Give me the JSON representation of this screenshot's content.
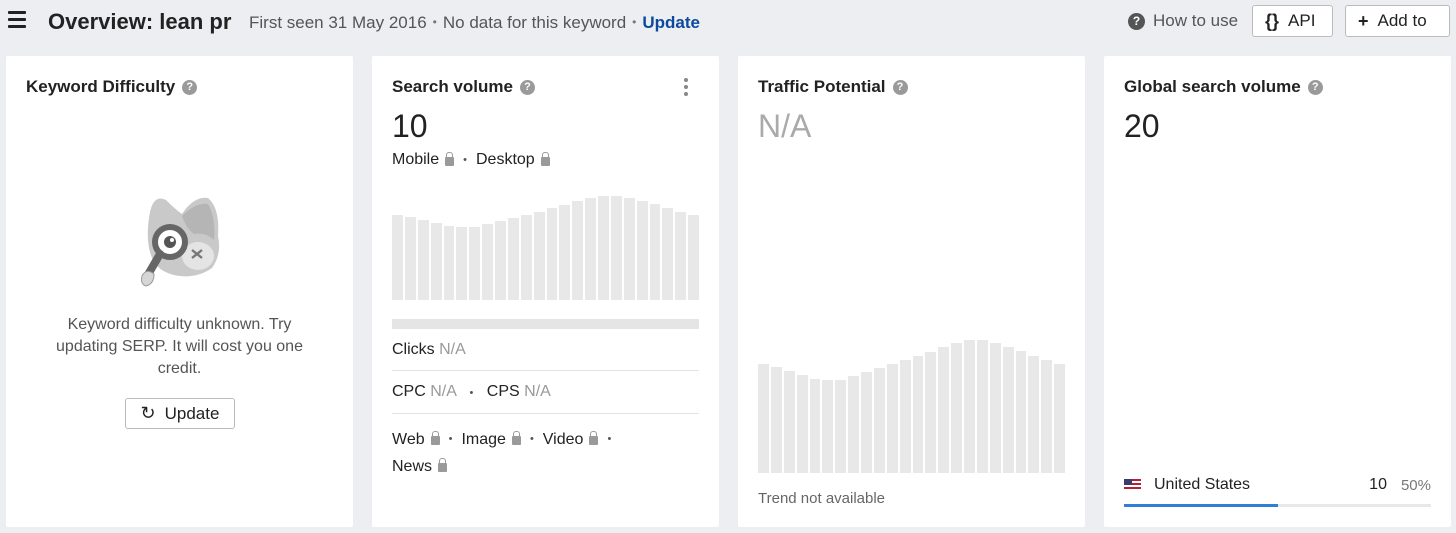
{
  "header": {
    "title": "Overview: lean pr",
    "first_seen": "First seen 31 May 2016",
    "no_data": "No data for this keyword",
    "update_link": "Update",
    "how_to_use": "How to use",
    "api_label": "API",
    "add_to_label": "Add to"
  },
  "keyword_difficulty": {
    "title": "Keyword Difficulty",
    "message": "Keyword difficulty unknown. Try updating SERP. It will cost you one credit.",
    "update_button": "Update"
  },
  "search_volume": {
    "title": "Search volume",
    "value": "10",
    "mobile_label": "Mobile",
    "desktop_label": "Desktop",
    "trend": [
      0.82,
      0.8,
      0.77,
      0.74,
      0.71,
      0.7,
      0.7,
      0.73,
      0.76,
      0.79,
      0.82,
      0.85,
      0.88,
      0.91,
      0.95,
      0.98,
      1.0,
      1.0,
      0.98,
      0.95,
      0.92,
      0.88,
      0.85,
      0.82
    ],
    "clicks_label": "Clicks",
    "clicks_value": "N/A",
    "cpc_label": "CPC",
    "cpc_value": "N/A",
    "cps_label": "CPS",
    "cps_value": "N/A",
    "types": [
      "Web",
      "Image",
      "Video",
      "News"
    ]
  },
  "traffic_potential": {
    "title": "Traffic Potential",
    "value": "N/A",
    "trend": [
      0.82,
      0.8,
      0.77,
      0.74,
      0.71,
      0.7,
      0.7,
      0.73,
      0.76,
      0.79,
      0.82,
      0.85,
      0.88,
      0.91,
      0.95,
      0.98,
      1.0,
      1.0,
      0.98,
      0.95,
      0.92,
      0.88,
      0.85,
      0.82
    ],
    "trend_note": "Trend not available"
  },
  "global_volume": {
    "title": "Global search volume",
    "value": "20",
    "country": "United States",
    "country_value": "10",
    "country_pct": "50%",
    "country_share": 0.5
  },
  "colors": {
    "accent": "#0b4a9e",
    "bar": "#e8e8e8",
    "progress": "#2f7fd6"
  }
}
